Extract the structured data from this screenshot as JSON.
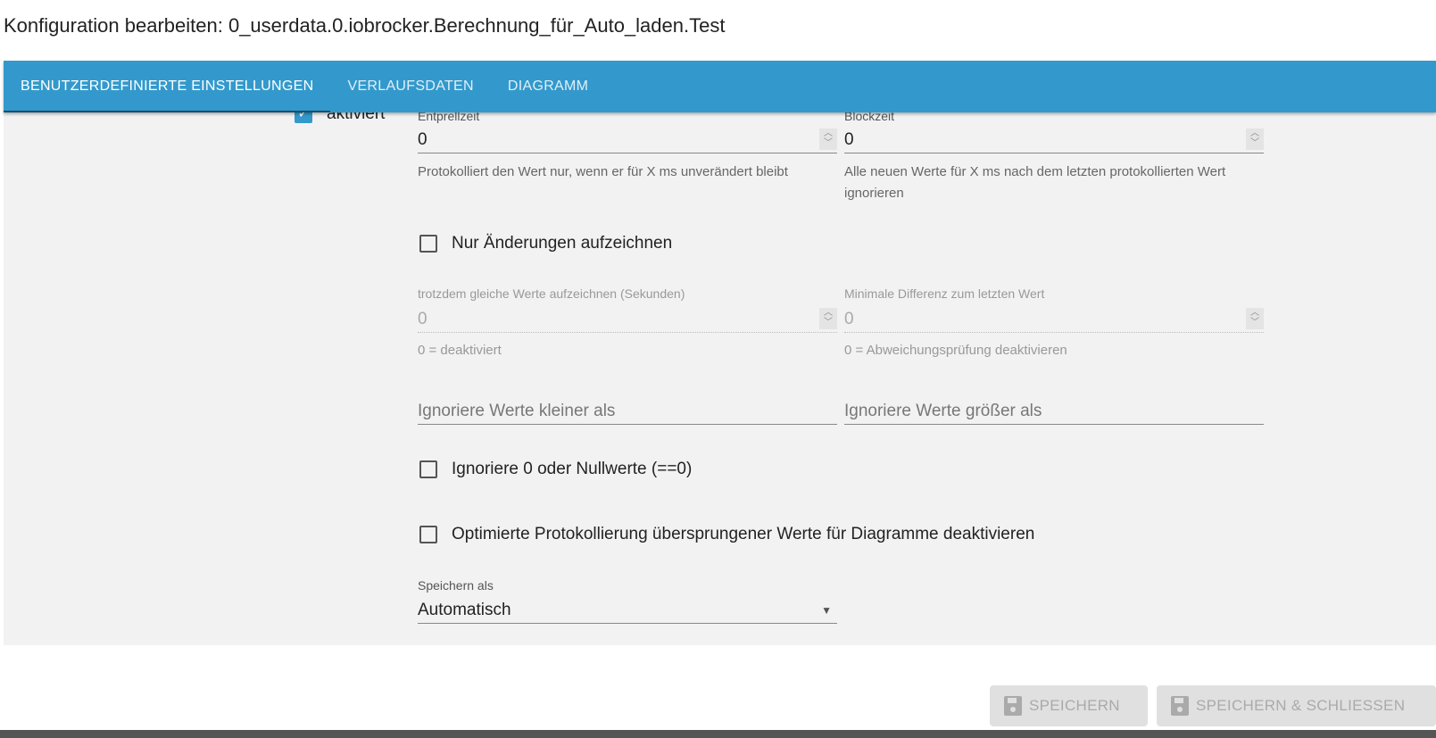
{
  "dialog": {
    "title": "Konfiguration bearbeiten: 0_userdata.0.iobrocker.Berechnung_für_Auto_laden.Test"
  },
  "tabs": [
    {
      "label": "BENUTZERDEFINIERTE EINSTELLUNGEN"
    },
    {
      "label": "VERLAUFSDATEN"
    },
    {
      "label": "DIAGRAMM"
    }
  ],
  "form": {
    "enabled": {
      "label": "aktiviert",
      "checked": true
    },
    "debounce": {
      "label": "Entprellzeit",
      "value": "0",
      "help": "Protokolliert den Wert nur, wenn er für X ms unverändert bleibt"
    },
    "blocktime": {
      "label": "Blockzeit",
      "value": "0",
      "help": "Alle neuen Werte für X ms nach dem letzten protokollierten Wert ignorieren"
    },
    "changesOnly": {
      "label": "Nur Änderungen aufzeichnen",
      "checked": false
    },
    "changesRelog": {
      "label": "trotzdem gleiche Werte aufzeichnen (Sekunden)",
      "value": "0",
      "help": "0 = deaktiviert"
    },
    "changesMinDelta": {
      "label": "Minimale Differenz zum letzten Wert",
      "value": "0",
      "help": "0 = Abweichungsprüfung deaktivieren"
    },
    "ignoreBelow": {
      "placeholder": "Ignoriere Werte kleiner als"
    },
    "ignoreAbove": {
      "placeholder": "Ignoriere Werte größer als"
    },
    "ignoreZero": {
      "label": "Ignoriere 0 oder Nullwerte (==0)",
      "checked": false
    },
    "disableSkipped": {
      "label": "Optimierte Protokollierung übersprungener Werte für Diagramme deaktivieren",
      "checked": false
    },
    "storageType": {
      "label": "Speichern als",
      "value": "Automatisch"
    }
  },
  "buttons": {
    "save": "SPEICHERN",
    "saveClose": "SPEICHERN & SCHLIESSEN"
  }
}
